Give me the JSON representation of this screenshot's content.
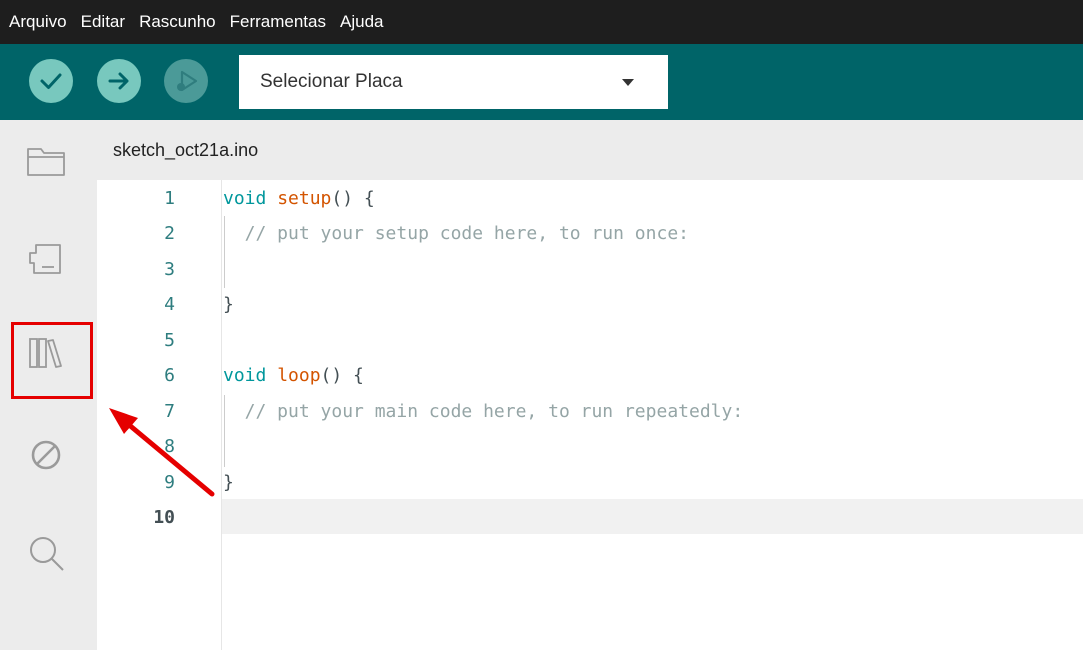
{
  "menubar": {
    "items": [
      "Arquivo",
      "Editar",
      "Rascunho",
      "Ferramentas",
      "Ajuda"
    ]
  },
  "toolbar": {
    "verify_icon": "check-icon",
    "upload_icon": "arrow-right-icon",
    "debug_icon": "debug-icon",
    "board_select": {
      "value": "Selecionar Placa"
    }
  },
  "sidebar": {
    "items": [
      {
        "name": "sketchbook",
        "icon": "folder-icon"
      },
      {
        "name": "boards-manager",
        "icon": "board-icon"
      },
      {
        "name": "library-manager",
        "icon": "library-icon"
      },
      {
        "name": "debug",
        "icon": "no-entry-icon"
      },
      {
        "name": "search",
        "icon": "search-icon"
      }
    ]
  },
  "tab": {
    "filename": "sketch_oct21a.ino"
  },
  "editor": {
    "lines": [
      {
        "num": "1",
        "parts": [
          [
            "kw",
            "void "
          ],
          [
            "fn",
            "setup"
          ],
          [
            "pn",
            "() {"
          ]
        ]
      },
      {
        "num": "2",
        "parts": [
          [
            "cm",
            "  // put your setup code here, to run once:"
          ]
        ]
      },
      {
        "num": "3",
        "parts": []
      },
      {
        "num": "4",
        "parts": [
          [
            "pn",
            "}"
          ]
        ]
      },
      {
        "num": "5",
        "parts": []
      },
      {
        "num": "6",
        "parts": [
          [
            "kw",
            "void "
          ],
          [
            "fn",
            "loop"
          ],
          [
            "pn",
            "() {"
          ]
        ]
      },
      {
        "num": "7",
        "parts": [
          [
            "cm",
            "  // put your main code here, to run repeatedly:"
          ]
        ]
      },
      {
        "num": "8",
        "parts": []
      },
      {
        "num": "9",
        "parts": [
          [
            "pn",
            "}"
          ]
        ]
      },
      {
        "num": "10",
        "parts": []
      }
    ]
  },
  "colors": {
    "menubar": "#1e1e1e",
    "toolbar": "#006468",
    "button": "#78c8be",
    "highlight": "#e50000"
  }
}
